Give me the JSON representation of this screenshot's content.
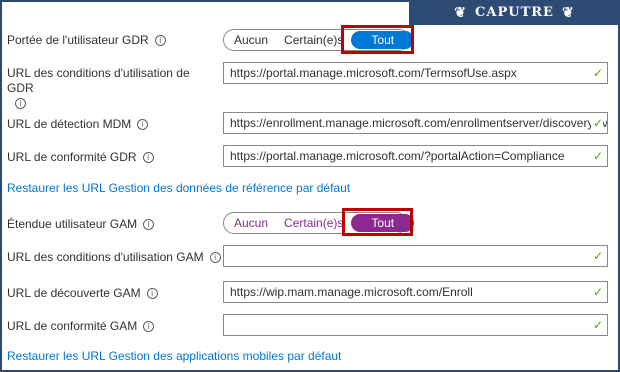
{
  "caption": {
    "text": "CAPUTRE",
    "laurel": "❦"
  },
  "gdr": {
    "scope_label": "Portée de l'utilisateur GDR",
    "scope_options": [
      "Aucun",
      "Certain(e)s",
      "Tout"
    ],
    "scope_selected": "Tout",
    "terms_label": "URL des conditions d'utilisation de GDR",
    "terms_value": "https://portal.manage.microsoft.com/TermsofUse.aspx",
    "discovery_label": "URL de détection MDM",
    "discovery_value": "https://enrollment.manage.microsoft.com/enrollmentserver/discovery.svc",
    "compliance_label": "URL de conformité GDR",
    "compliance_value": "https://portal.manage.microsoft.com/?portalAction=Compliance",
    "restore_link": "Restaurer les URL Gestion des données de référence par défaut"
  },
  "gam": {
    "scope_label": "Étendue utilisateur GAM",
    "scope_options": [
      "Aucun",
      "Certain(e)s",
      "Tout"
    ],
    "scope_selected": "Tout",
    "terms_label": "URL des conditions d'utilisation GAM",
    "terms_value": "",
    "discovery_label": "URL de découverte GAM",
    "discovery_value": "https://wip.mam.manage.microsoft.com/Enroll",
    "compliance_label": "URL de conformité GAM",
    "compliance_value": "",
    "restore_link": "Restaurer les URL Gestion des applications mobiles par défaut"
  },
  "icons": {
    "info": "info-icon",
    "check": "checkmark-icon"
  },
  "colors": {
    "accent_blue": "#0078d4",
    "accent_purple": "#8a2a8e",
    "highlight": "#c00000",
    "check": "#57a300"
  }
}
